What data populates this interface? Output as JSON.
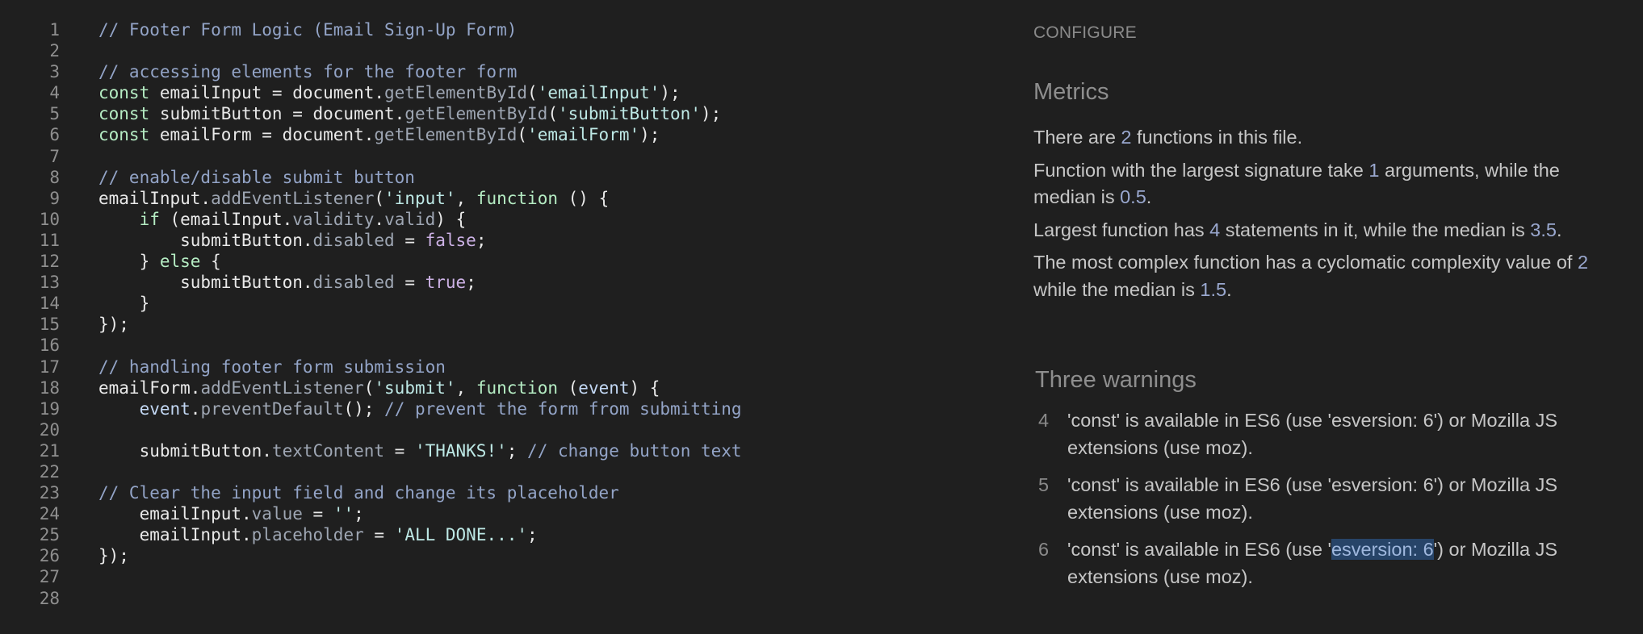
{
  "editor": {
    "lines": [
      {
        "n": "1",
        "tokens": [
          {
            "t": "// Footer Form Logic (Email Sign-Up Form)",
            "c": "cm"
          }
        ]
      },
      {
        "n": "2",
        "tokens": []
      },
      {
        "n": "3",
        "tokens": [
          {
            "t": "// accessing elements for the footer form",
            "c": "cm"
          }
        ]
      },
      {
        "n": "4",
        "tokens": [
          {
            "t": "const",
            "c": "kw"
          },
          {
            "t": " emailInput = document.",
            "c": "pl"
          },
          {
            "t": "getElementById",
            "c": "prop"
          },
          {
            "t": "(",
            "c": "pl"
          },
          {
            "t": "'emailInput'",
            "c": "str"
          },
          {
            "t": ");",
            "c": "pl"
          }
        ]
      },
      {
        "n": "5",
        "tokens": [
          {
            "t": "const",
            "c": "kw"
          },
          {
            "t": " submitButton = document.",
            "c": "pl"
          },
          {
            "t": "getElementById",
            "c": "prop"
          },
          {
            "t": "(",
            "c": "pl"
          },
          {
            "t": "'submitButton'",
            "c": "str"
          },
          {
            "t": ");",
            "c": "pl"
          }
        ]
      },
      {
        "n": "6",
        "tokens": [
          {
            "t": "const",
            "c": "kw"
          },
          {
            "t": " emailForm = document.",
            "c": "pl"
          },
          {
            "t": "getElementById",
            "c": "prop"
          },
          {
            "t": "(",
            "c": "pl"
          },
          {
            "t": "'emailForm'",
            "c": "str"
          },
          {
            "t": ");",
            "c": "pl"
          }
        ]
      },
      {
        "n": "7",
        "tokens": []
      },
      {
        "n": "8",
        "tokens": [
          {
            "t": "// enable/disable submit button",
            "c": "cm"
          }
        ]
      },
      {
        "n": "9",
        "tokens": [
          {
            "t": "emailInput.",
            "c": "pl"
          },
          {
            "t": "addEventListener",
            "c": "prop"
          },
          {
            "t": "(",
            "c": "pl"
          },
          {
            "t": "'input'",
            "c": "str"
          },
          {
            "t": ", ",
            "c": "pl"
          },
          {
            "t": "function",
            "c": "kw"
          },
          {
            "t": " () {",
            "c": "pl"
          }
        ]
      },
      {
        "n": "10",
        "tokens": [
          {
            "t": "    ",
            "c": "pl"
          },
          {
            "t": "if",
            "c": "kw"
          },
          {
            "t": " (emailInput.",
            "c": "pl"
          },
          {
            "t": "validity",
            "c": "prop"
          },
          {
            "t": ".",
            "c": "pl"
          },
          {
            "t": "valid",
            "c": "prop"
          },
          {
            "t": ") {",
            "c": "pl"
          }
        ]
      },
      {
        "n": "11",
        "tokens": [
          {
            "t": "        submitButton.",
            "c": "pl"
          },
          {
            "t": "disabled",
            "c": "prop"
          },
          {
            "t": " = ",
            "c": "pl"
          },
          {
            "t": "false",
            "c": "bool"
          },
          {
            "t": ";",
            "c": "pl"
          }
        ]
      },
      {
        "n": "12",
        "tokens": [
          {
            "t": "    } ",
            "c": "pl"
          },
          {
            "t": "else",
            "c": "kw"
          },
          {
            "t": " {",
            "c": "pl"
          }
        ]
      },
      {
        "n": "13",
        "tokens": [
          {
            "t": "        submitButton.",
            "c": "pl"
          },
          {
            "t": "disabled",
            "c": "prop"
          },
          {
            "t": " = ",
            "c": "pl"
          },
          {
            "t": "true",
            "c": "bool"
          },
          {
            "t": ";",
            "c": "pl"
          }
        ]
      },
      {
        "n": "14",
        "tokens": [
          {
            "t": "    }",
            "c": "pl"
          }
        ]
      },
      {
        "n": "15",
        "tokens": [
          {
            "t": "});",
            "c": "pl"
          }
        ]
      },
      {
        "n": "16",
        "tokens": []
      },
      {
        "n": "17",
        "tokens": [
          {
            "t": "// handling footer form submission",
            "c": "cm"
          }
        ]
      },
      {
        "n": "18",
        "tokens": [
          {
            "t": "emailForm.",
            "c": "pl"
          },
          {
            "t": "addEventListener",
            "c": "prop"
          },
          {
            "t": "(",
            "c": "pl"
          },
          {
            "t": "'submit'",
            "c": "str"
          },
          {
            "t": ", ",
            "c": "pl"
          },
          {
            "t": "function",
            "c": "kw"
          },
          {
            "t": " (",
            "c": "pl"
          },
          {
            "t": "event",
            "c": "ev"
          },
          {
            "t": ") {",
            "c": "pl"
          }
        ]
      },
      {
        "n": "19",
        "tokens": [
          {
            "t": "    ",
            "c": "pl"
          },
          {
            "t": "event",
            "c": "ev"
          },
          {
            "t": ".",
            "c": "pl"
          },
          {
            "t": "preventDefault",
            "c": "prop"
          },
          {
            "t": "(); ",
            "c": "pl"
          },
          {
            "t": "// prevent the form from submitting",
            "c": "cm"
          }
        ]
      },
      {
        "n": "20",
        "tokens": []
      },
      {
        "n": "21",
        "tokens": [
          {
            "t": "    submitButton.",
            "c": "pl"
          },
          {
            "t": "textContent",
            "c": "prop"
          },
          {
            "t": " = ",
            "c": "pl"
          },
          {
            "t": "'THANKS!'",
            "c": "str"
          },
          {
            "t": "; ",
            "c": "pl"
          },
          {
            "t": "// change button text",
            "c": "cm"
          }
        ]
      },
      {
        "n": "22",
        "tokens": []
      },
      {
        "n": "23",
        "tokens": [
          {
            "t": "// Clear the input field and change its placeholder",
            "c": "cm"
          }
        ]
      },
      {
        "n": "24",
        "tokens": [
          {
            "t": "    emailInput.",
            "c": "pl"
          },
          {
            "t": "value",
            "c": "prop"
          },
          {
            "t": " = ",
            "c": "pl"
          },
          {
            "t": "''",
            "c": "str"
          },
          {
            "t": ";",
            "c": "pl"
          }
        ]
      },
      {
        "n": "25",
        "tokens": [
          {
            "t": "    emailInput.",
            "c": "pl"
          },
          {
            "t": "placeholder",
            "c": "prop"
          },
          {
            "t": " = ",
            "c": "pl"
          },
          {
            "t": "'ALL DONE...'",
            "c": "str"
          },
          {
            "t": ";",
            "c": "pl"
          }
        ]
      },
      {
        "n": "26",
        "tokens": [
          {
            "t": "});",
            "c": "pl"
          }
        ]
      },
      {
        "n": "27",
        "tokens": []
      },
      {
        "n": "28",
        "tokens": []
      }
    ]
  },
  "report": {
    "configure_label": "CONFIGURE",
    "metrics_heading": "Metrics",
    "metrics": [
      [
        {
          "t": "There are "
        },
        {
          "t": "2",
          "num": true
        },
        {
          "t": " functions in this file."
        }
      ],
      [
        {
          "t": "Function with the largest signature take "
        },
        {
          "t": "1",
          "num": true
        },
        {
          "t": " arguments, while the median is "
        },
        {
          "t": "0.5",
          "num": true
        },
        {
          "t": "."
        }
      ],
      [
        {
          "t": "Largest function has "
        },
        {
          "t": "4",
          "num": true
        },
        {
          "t": " statements in it, while the median is "
        },
        {
          "t": "3.5",
          "num": true
        },
        {
          "t": "."
        }
      ],
      [
        {
          "t": "The most complex function has a cyclomatic complexity value of "
        },
        {
          "t": "2",
          "num": true
        },
        {
          "t": " while the median is "
        },
        {
          "t": "1.5",
          "num": true
        },
        {
          "t": "."
        }
      ]
    ],
    "warnings_heading": "Three warnings",
    "warnings": [
      {
        "line": "4",
        "parts": [
          {
            "t": "'const' is available in ES6 (use 'esversion: 6') or Mozilla JS extensions (use moz)."
          }
        ]
      },
      {
        "line": "5",
        "parts": [
          {
            "t": "'const' is available in ES6 (use 'esversion: 6') or Mozilla JS extensions (use moz)."
          }
        ]
      },
      {
        "line": "6",
        "parts": [
          {
            "t": "'const' is available in ES6 (use '"
          },
          {
            "t": "esversion: 6",
            "sel": true
          },
          {
            "t": "') or Mozilla JS extensions (use moz)."
          }
        ]
      }
    ]
  },
  "colors": {
    "background": "#1f1f1f",
    "comment": "#93a4c7",
    "keyword": "#b5ecc3",
    "string": "#bde8e5",
    "number_highlight": "#9aa8cf",
    "selection": "#274468"
  }
}
